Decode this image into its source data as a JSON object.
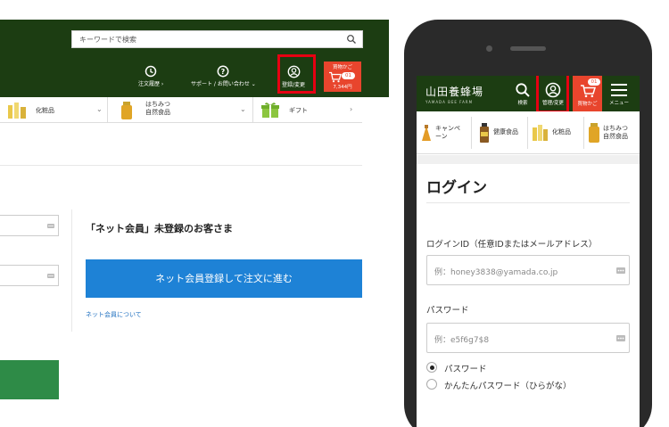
{
  "desktop": {
    "search": {
      "placeholder": "キーワードで検索"
    },
    "header_items": {
      "order_history": "注文履歴 ›",
      "support": "サポート / お問い合わせ ⌄",
      "account": "登録/変更",
      "cart_label": "買物かご",
      "cart_count": "01",
      "cart_total": "7,344円"
    },
    "nav": {
      "cosmetics": "化粧品",
      "honey_line1": "はちみつ",
      "honey_line2": "自然食品",
      "gift": "ギフト"
    },
    "register": {
      "title": "「ネット会員」未登録のお客さま",
      "button": "ネット会員登録して注文に進む",
      "link": "ネット会員について"
    }
  },
  "mobile": {
    "logo": "山田養蜂場",
    "logo_sub": "YAMADA BEE FARM",
    "header": {
      "search": "検索",
      "account": "管理/変更",
      "cart": "買物かご",
      "cart_count": "01",
      "menu": "メニュー"
    },
    "categories": {
      "campaign_line1": "キャンペ",
      "campaign_line2": "ーン",
      "health": "健康食品",
      "cosmetics": "化粧品",
      "honey_line1": "はちみつ",
      "honey_line2": "自然食品"
    },
    "login": {
      "title": "ログイン",
      "id_label": "ログインID（任意IDまたはメールアドレス）",
      "id_placeholder": "例：honey3838@yamada.co.jp",
      "password_label": "パスワード",
      "password_placeholder": "例：e5f6g7$8",
      "radio_password": "パスワード",
      "radio_easy": "かんたんパスワード（ひらがな）"
    }
  },
  "colors": {
    "header_green": "#1c3d12",
    "cart_red": "#e8452d",
    "highlight_red": "#e60012",
    "button_blue": "#1e82d6",
    "button_green": "#2e8b47"
  },
  "icons": [
    "search-icon",
    "clock-history-icon",
    "question-circle-icon",
    "user-circle-icon",
    "cart-icon",
    "menu-icon",
    "dots-icon"
  ]
}
